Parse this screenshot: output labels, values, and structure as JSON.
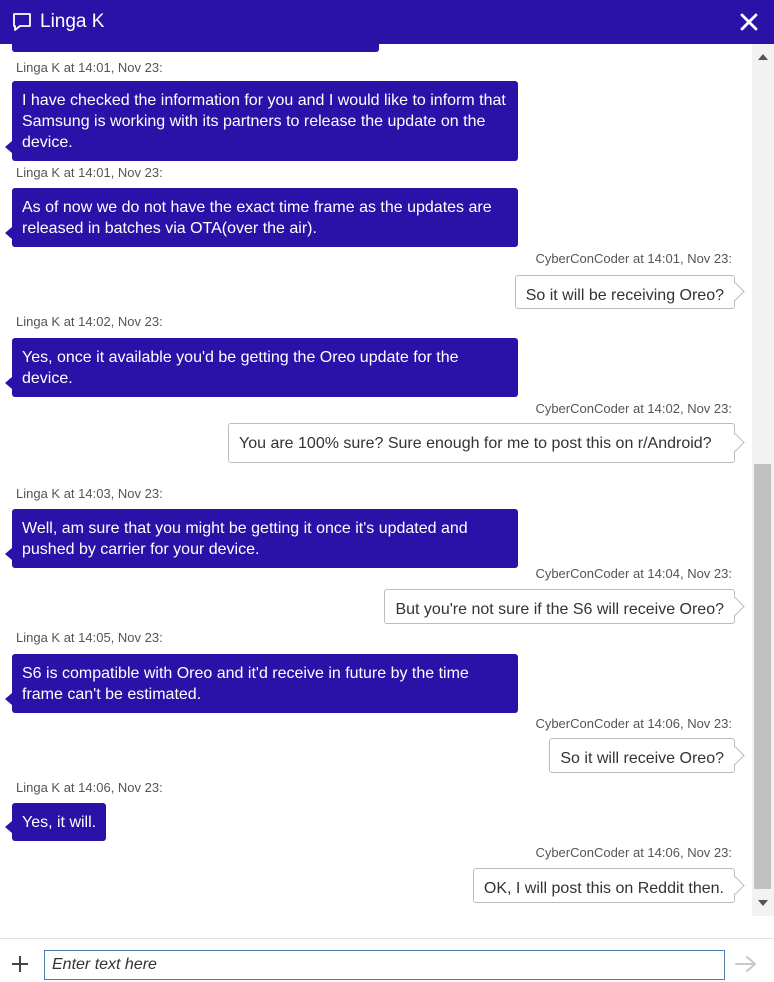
{
  "header": {
    "title": "Linga K",
    "accent_color": "#2a12a8",
    "chat_icon": "chat-bubble-icon",
    "close_icon": "close-icon"
  },
  "messages": [
    {
      "sender": "agent",
      "meta": "Linga K at 14:01, Nov 23:",
      "text": "I have checked the information for you and I would like to inform that Samsung is working with its partners to release the update on the device."
    },
    {
      "sender": "agent",
      "meta": "Linga K at 14:01, Nov 23:",
      "text": "As of now we do not have the exact time frame as the updates are released in batches via OTA(over the air)."
    },
    {
      "sender": "user",
      "meta": "CyberConCoder at 14:01, Nov 23:",
      "text": "So it will be receiving Oreo?"
    },
    {
      "sender": "agent",
      "meta": "Linga K at 14:02, Nov 23:",
      "text": "Yes, once it available you'd be getting the Oreo update for the device."
    },
    {
      "sender": "user",
      "meta": "CyberConCoder at 14:02, Nov 23:",
      "text": "You are 100% sure? Sure enough for me to post this on r/Android?"
    },
    {
      "sender": "agent",
      "meta": "Linga K at 14:03, Nov 23:",
      "text": "Well, am sure that you might be getting it once it's updated and pushed by carrier for your device."
    },
    {
      "sender": "user",
      "meta": "CyberConCoder at 14:04, Nov 23:",
      "text": "But you're not sure if the S6 will receive Oreo?"
    },
    {
      "sender": "agent",
      "meta": "Linga K at 14:05, Nov 23:",
      "text": "S6 is compatible with Oreo and it'd receive in future by the time frame can't be estimated."
    },
    {
      "sender": "user",
      "meta": "CyberConCoder at 14:06, Nov 23:",
      "text": "So it will receive Oreo?"
    },
    {
      "sender": "agent",
      "meta": "Linga K at 14:06, Nov 23:",
      "text": "Yes, it will."
    },
    {
      "sender": "user",
      "meta": "CyberConCoder at 14:06, Nov 23:",
      "text": "OK, I will post this on Reddit then."
    }
  ],
  "composer": {
    "placeholder": "Enter text here",
    "value": "",
    "add_icon": "plus-icon",
    "send_icon": "send-arrow-icon"
  }
}
